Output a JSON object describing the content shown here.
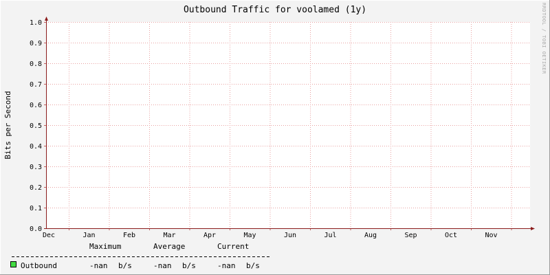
{
  "chart_data": {
    "type": "line",
    "title": "Outbound Traffic for voolamed (1y)",
    "ylabel": "Bits per Second",
    "xlabel": "",
    "ylim": [
      0.0,
      1.0
    ],
    "y_ticks": [
      "0.0",
      "0.1",
      "0.2",
      "0.3",
      "0.4",
      "0.5",
      "0.6",
      "0.7",
      "0.8",
      "0.9",
      "1.0"
    ],
    "x_ticks": [
      "Dec",
      "Jan",
      "Feb",
      "Mar",
      "Apr",
      "May",
      "Jun",
      "Jul",
      "Aug",
      "Sep",
      "Oct",
      "Nov"
    ],
    "grid": true,
    "series": [
      {
        "name": "Outbound",
        "color": "#44dd44",
        "values": []
      }
    ],
    "watermark": "RRDTOOL / TOBI OETIKER",
    "legend": {
      "headers": [
        "Maximum",
        "Average",
        "Current"
      ],
      "rows": [
        {
          "name": "Outbound",
          "swatch_color": "#44dd44",
          "maximum": "-nan",
          "average": "-nan",
          "current": "-nan",
          "unit": "b/s"
        }
      ]
    }
  }
}
